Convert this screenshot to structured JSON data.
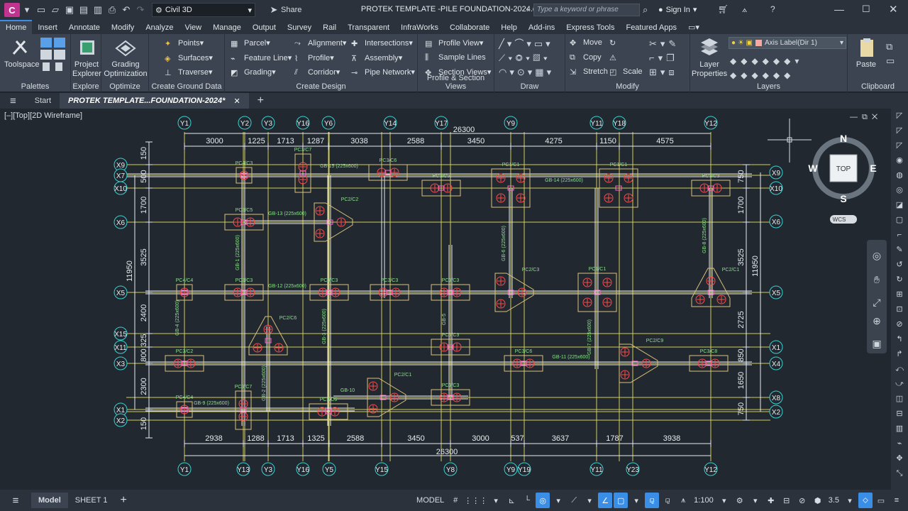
{
  "app": {
    "logo": "C",
    "workspace": "Civil 3D",
    "share": "Share",
    "title": "PROTEK  TEMPLATE -PILE FOUNDATION-2024.dwg",
    "search_placeholder": "Type a keyword or phrase",
    "signin": "Sign In"
  },
  "menu_tabs": [
    "Home",
    "Insert",
    "Annotate",
    "Modify",
    "Analyze",
    "View",
    "Manage",
    "Output",
    "Survey",
    "Rail",
    "Transparent",
    "InfraWorks",
    "Collaborate",
    "Help",
    "Add-ins",
    "Express Tools",
    "Featured Apps"
  ],
  "ribbon": {
    "palettes": {
      "toolspace": "Toolspace",
      "title": "Palettes"
    },
    "explore": {
      "project_explorer": "Project Explorer",
      "title": "Explore"
    },
    "optimize": {
      "grading": "Grading Optimization",
      "title": "Optimize"
    },
    "ground": {
      "items": [
        "Points",
        "Surfaces",
        "Traverse"
      ],
      "title": "Create Ground Data"
    },
    "design": {
      "col1": [
        "Parcel",
        "Feature Line",
        "Grading"
      ],
      "col2": [
        "Alignment",
        "Profile",
        "Corridor"
      ],
      "col3": [
        "Intersections",
        "Assembly",
        "Pipe Network"
      ],
      "title": "Create Design"
    },
    "profile": {
      "items": [
        "Profile View",
        "Sample Lines",
        "Section Views"
      ],
      "title": "Profile & Section Views"
    },
    "draw": {
      "title": "Draw"
    },
    "modify": {
      "items": [
        "Move",
        "Copy",
        "Stretch",
        "Scale"
      ],
      "title": "Modify"
    },
    "layers": {
      "layer_props": "Layer Properties",
      "current": "Axis Label(Dir 1)",
      "title": "Layers"
    },
    "clipboard": {
      "paste": "Paste",
      "title": "Clipboard"
    }
  },
  "doc_tabs": {
    "start": "Start",
    "active": "PROTEK  TEMPLATE...FOUNDATION-2024*"
  },
  "viewport": {
    "label": "[–][Top][2D Wireframe]",
    "viewcube": {
      "top": "TOP",
      "n": "N",
      "s": "S",
      "e": "E",
      "w": "W",
      "wcs": "WCS"
    }
  },
  "drawing": {
    "grid_top": [
      "Y1",
      "Y2",
      "Y3",
      "Y16",
      "Y6",
      "Y14",
      "Y17",
      "Y9",
      "Y11",
      "Y18",
      "Y12"
    ],
    "grid_bottom": [
      "Y1",
      "Y13",
      "Y3",
      "Y16",
      "Y5",
      "Y15",
      "Y8",
      "Y9",
      "Y19",
      "Y11",
      "Y23",
      "Y12"
    ],
    "grid_left": [
      "X9",
      "X7",
      "X10",
      "X6",
      "X5",
      "X15",
      "X11",
      "X3",
      "X1",
      "X2"
    ],
    "grid_right": [
      "X9",
      "X10",
      "X6",
      "X5",
      "X1",
      "X4",
      "X8",
      "X2"
    ],
    "dims_top": [
      "3000",
      "1225",
      "1713",
      "1287",
      "3038",
      "2588",
      "3450",
      "4275",
      "1150",
      "4575"
    ],
    "dims_bottom": [
      "2938",
      "1288",
      "1713",
      "1325",
      "2588",
      "3450",
      "3000",
      "537",
      "3637",
      "1787",
      "3938"
    ],
    "total": "26300",
    "dims_left": [
      "150",
      "500",
      "1700",
      "3525",
      "2400",
      "325",
      "800",
      "2300",
      "150"
    ],
    "dims_right": [
      "750",
      "1700",
      "3525",
      "2725",
      "850",
      "1650",
      "750"
    ],
    "total_side": "11950",
    "pile_caps": [
      "PC4/C3",
      "PC3/C7",
      "PC3/C6",
      "PC3/C5",
      "PC1/C1",
      "PC1/C1",
      "PC3/C3",
      "PC3/C5",
      "PC2/C2",
      "PC4/C4",
      "PC3/C3",
      "PC3/C3",
      "PC3/C3",
      "PC3/C3",
      "PC2/C3",
      "PC1/C1",
      "PC2/C1",
      "PC2/C6",
      "PC3/C2",
      "PC3/C3",
      "PC3/C6",
      "PC2/C9",
      "PC3/C8",
      "PC4/C4",
      "PC3/C7",
      "PC3/C6",
      "PC2/C1",
      "PC3/C3"
    ],
    "beams": [
      "GB-15 (225x600)",
      "GB-14 (225x600)",
      "GB-13 (225x600)",
      "GB-12 (225x600)",
      "GB-11 (225x600)",
      "GB-10",
      "GB-9 (225x600)",
      "GB-8 (225x600)",
      "GB-7 (225x600)",
      "GB-6 (225x600)",
      "GB-5",
      "GB-4 (225x600)",
      "GB-3 (225x600)",
      "GB-2 (225x600)",
      "GB-1 (225x600)"
    ]
  },
  "status": {
    "model_tab": "Model",
    "sheet_tab": "SHEET 1",
    "model": "MODEL",
    "scale": "1:100",
    "zoom": "3.5"
  },
  "colors": {
    "accent": "#3b8ee6",
    "grid": "#d4cc5a",
    "caps": "#d9c27a",
    "labels": "#8de08d",
    "pile": "#ff4a4a"
  }
}
